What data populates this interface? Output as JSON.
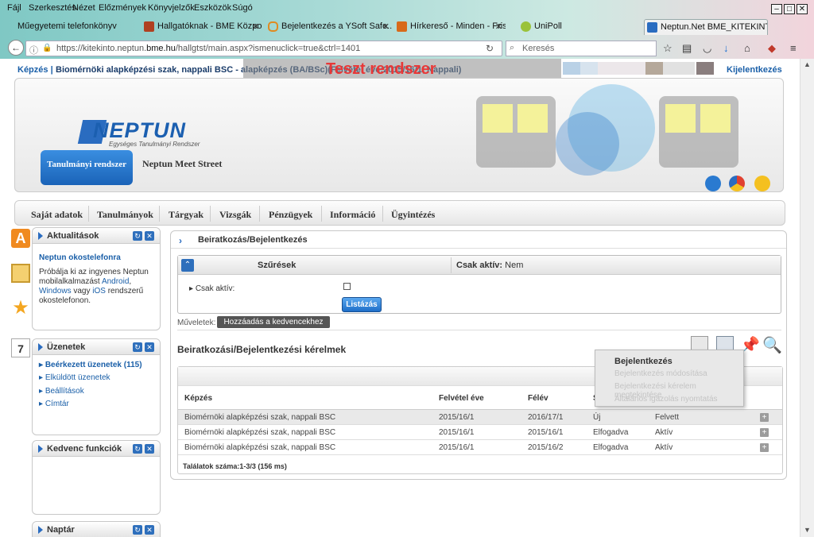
{
  "browser": {
    "menu": [
      "Fájl",
      "Szerkesztés",
      "Nézet",
      "Előzmények",
      "Könyvjelzők",
      "Eszközök",
      "Súgó"
    ],
    "tabs": [
      {
        "label": "Műegyetemi telefonkönyv"
      },
      {
        "label": "Hallgatóknak - BME Közpo..."
      },
      {
        "label": "Bejelentkezés a YSoft Safe..."
      },
      {
        "label": "Hírkereső - Minden - Friss ..."
      },
      {
        "label": "UniPoll"
      },
      {
        "label": "Neptun.Net BME_KITEKINT..."
      }
    ],
    "url_prefix": "https://kitekinto.neptun.",
    "url_domain": "bme.hu",
    "url_path": "/hallgtst/main.aspx?ismenuclick=true&ctrl=1401",
    "search_placeholder": "Keresés",
    "window_min": "–",
    "window_max": "□",
    "window_close": "✕"
  },
  "topbar": {
    "crumb_label": "Képzés",
    "crumb_sep": "|",
    "crumb_value": "Biomérnöki alapképzési szak, nappali BSC - alapképzés (BA/BSc)(Felvétel éve:2015/16/1, Nappali)",
    "test_label": "Teszt rendszer",
    "logout": "Kijelentkezés",
    "swatch_colors": [
      "#b9d1e6",
      "#d7e3ee",
      "#ece7ea",
      "#e6e6e6",
      "#b5a89a",
      "#e1e1e1",
      "#8a7e7e"
    ]
  },
  "header": {
    "logo_text": "NEPTUN",
    "logo_sub": "Egységes Tanulmányi Rendszer",
    "tab_active": "Tanulmányi rendszer",
    "tab_other": "Neptun Meet Street"
  },
  "mainmenu": [
    "Saját adatok",
    "Tanulmányok",
    "Tárgyak",
    "Vizsgák",
    "Pénzügyek",
    "Információ",
    "Ügyintézés"
  ],
  "sidebar": {
    "news": {
      "title": "Aktualitások",
      "headline": "Neptun okostelefonra",
      "p1": "Próbálja ki az ingyenes Neptun mobilalkalmazást",
      "android": "Android",
      "comma": ",",
      "windows": "Windows",
      "or": "vagy",
      "ios": "iOS",
      "p2": "rendszerű okostelefonon."
    },
    "messages": {
      "title": "Üzenetek",
      "items": [
        "Beérkezett üzenetek (115)",
        "Elküldött üzenetek",
        "Beállítások",
        "Címtár"
      ]
    },
    "favorites": {
      "title": "Kedvenc funkciók"
    },
    "calendar": {
      "title": "Naptár"
    }
  },
  "content": {
    "title": "Beiratkozás/Bejelentkezés",
    "filter": {
      "title": "Szűrések",
      "active_label": "Csak aktív:",
      "active_value": "Nem",
      "checkbox_label": "Csak aktív:",
      "list_button": "Listázás"
    },
    "ops_label": "Műveletek:",
    "fav_button": "Hozzáadás a kedvencekhez",
    "requests_title": "Beiratkozási/Bejelentkezési kérelmek",
    "columns": [
      "Képzés",
      "Felvétel éve",
      "Félév",
      "S"
    ],
    "rows": [
      {
        "kepzes": "Biomérnöki alapképzési szak, nappali BSC",
        "felvetel": "2015/16/1",
        "felev": "2016/17/1",
        "status": "Új",
        "state": "Felvett"
      },
      {
        "kepzes": "Biomérnöki alapképzési szak, nappali BSC",
        "felvetel": "2015/16/1",
        "felev": "2015/16/1",
        "status": "Elfogadva",
        "state": "Aktív"
      },
      {
        "kepzes": "Biomérnöki alapképzési szak, nappali BSC",
        "felvetel": "2015/16/1",
        "felev": "2015/16/2",
        "status": "Elfogadva",
        "state": "Aktív"
      }
    ],
    "footer": "Találatok száma:1-3/3 (156 ms)",
    "context_menu": [
      "Bejelentkezés",
      "Bejelentkezés módosítása",
      "Bejelentkezési kérelem megtekintése",
      "Általános igazolás nyomtatás"
    ]
  }
}
